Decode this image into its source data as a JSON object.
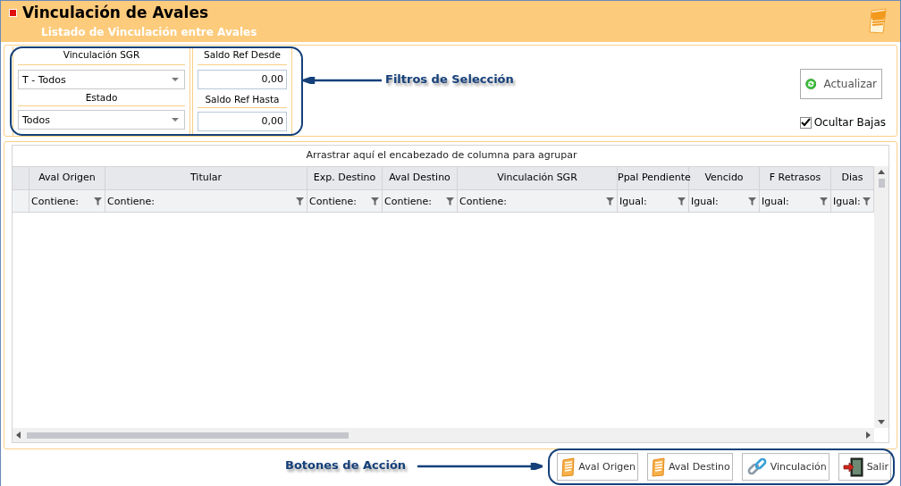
{
  "window": {
    "title": "Vinculación de Avales",
    "subtitle": "Listado de Vinculación entre Avales"
  },
  "filter_groups": [
    [
      {
        "label": "Vinculación SGR",
        "value": "T - Todos",
        "kind": "select"
      },
      {
        "label": "Estado",
        "value": "Todos",
        "kind": "select"
      }
    ],
    [
      {
        "label": "Saldo Ref Desde",
        "value": "0,00",
        "kind": "number"
      },
      {
        "label": "Saldo Ref Hasta",
        "value": "0,00",
        "kind": "number"
      }
    ]
  ],
  "refresh_button": {
    "label": "Actualizar"
  },
  "hide_inactive": {
    "label": "Ocultar Bajas",
    "checked": true
  },
  "grid": {
    "group_panel": "Arrastrar aquí el encabezado de columna para agrupar",
    "columns": [
      {
        "header": "Aval Origen",
        "filter": "Contiene:"
      },
      {
        "header": "Titular",
        "filter": "Contiene:"
      },
      {
        "header": "Exp. Destino",
        "filter": "Contiene:"
      },
      {
        "header": "Aval Destino",
        "filter": "Contiene:"
      },
      {
        "header": "Vinculación SGR",
        "filter": "Contiene:"
      },
      {
        "header": "Ppal Pendiente",
        "filter": "Igual:"
      },
      {
        "header": "Vencido",
        "filter": "Igual:"
      },
      {
        "header": "F Retrasos",
        "filter": "Igual:"
      },
      {
        "header": "Dias",
        "filter": "Igual:"
      }
    ]
  },
  "action_buttons": [
    {
      "label": "Aval Origen",
      "kind": "document"
    },
    {
      "label": "Aval Destino",
      "kind": "document"
    },
    {
      "label": "Vinculación",
      "kind": "link"
    },
    {
      "label": "Salir",
      "kind": "exit"
    }
  ],
  "annotations": [
    {
      "label": "Filtros de Selección",
      "kind": "filters"
    },
    {
      "label": "Botones de Acción",
      "kind": "actions"
    }
  ]
}
